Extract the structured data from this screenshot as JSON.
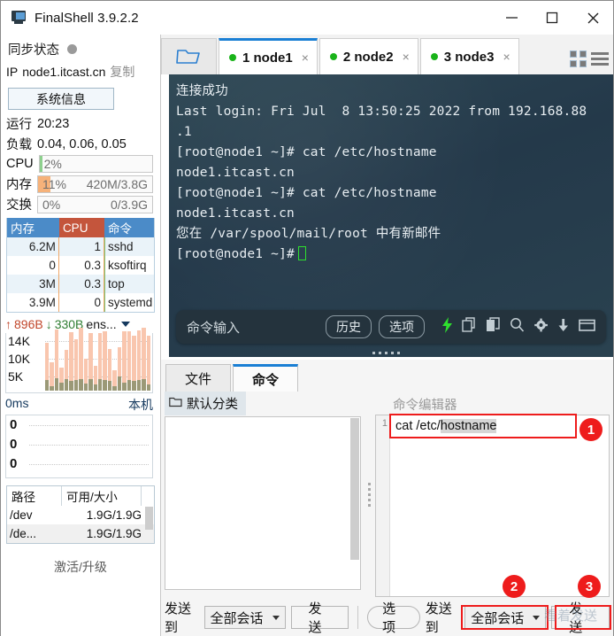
{
  "window": {
    "title": "FinalShell 3.9.2.2",
    "app_icon": "monitor-icon",
    "minimize": "minimize-icon",
    "maximize": "maximize-icon",
    "close": "close-icon"
  },
  "sidebar": {
    "sync_label": "同步状态",
    "ip_label": "IP",
    "ip_value": "node1.itcast.cn",
    "copy_label": "复制",
    "sysinfo_button": "系统信息",
    "stats": [
      {
        "key": "运行",
        "value": "20:23",
        "type": "text"
      },
      {
        "key": "负载",
        "value": "0.04, 0.06, 0.05",
        "type": "text"
      }
    ],
    "meters": [
      {
        "key": "CPU",
        "pct_text": "2%",
        "pct": 2,
        "right_text": "",
        "color": "#8ed08e"
      },
      {
        "key": "内存",
        "pct_text": "11%",
        "pct": 11,
        "right_text": "420M/3.8G",
        "color": "#f6b27a"
      },
      {
        "key": "交换",
        "pct_text": "0%",
        "pct": 0,
        "right_text": "0/3.9G",
        "color": "#f6b27a"
      }
    ],
    "process_table": {
      "headers": [
        "内存",
        "CPU",
        "命令"
      ],
      "rows": [
        {
          "mem": "6.2M",
          "cpu": "1",
          "cmd": "sshd"
        },
        {
          "mem": "0",
          "cpu": "0.3",
          "cmd": "ksoftirq"
        },
        {
          "mem": "3M",
          "cpu": "0.3",
          "cmd": "top"
        },
        {
          "mem": "3.9M",
          "cpu": "0",
          "cmd": "systemd"
        }
      ]
    },
    "network": {
      "up_arrow": "↑",
      "up_value": "896B",
      "down_arrow": "↓",
      "down_value": "330B",
      "interface": "ens...",
      "dropdown_icon": "chevron-down-icon",
      "y_labels": [
        "14K",
        "10K",
        "5K"
      ],
      "latency": "0ms",
      "host_label": "本机",
      "latency_y_labels": [
        "0",
        "0",
        "0"
      ]
    },
    "disk_table": {
      "headers": [
        "路径",
        "可用/大小",
        ""
      ],
      "rows": [
        {
          "path": "/dev",
          "size": "1.9G/1.9G"
        },
        {
          "path": "/de...",
          "size": "1.9G/1.9G"
        }
      ]
    },
    "activate_label": "激活/升级"
  },
  "tabbar": {
    "folder_icon": "open-folder-icon",
    "tabs": [
      {
        "label": "1 node1",
        "active": true,
        "status": "connected",
        "close": "×"
      },
      {
        "label": "2 node2",
        "active": false,
        "status": "connected",
        "close": "×"
      },
      {
        "label": "3 node3",
        "active": false,
        "status": "connected",
        "close": "×"
      }
    ],
    "grid_icon": "grid-view-icon",
    "menu_icon": "hamburger-menu-icon"
  },
  "terminal": {
    "lines": [
      "连接成功",
      "Last login: Fri Jul  8 13:50:25 2022 from 192.168.88",
      ".1",
      "[root@node1 ~]# cat /etc/hostname",
      "node1.itcast.cn",
      "[root@node1 ~]# cat /etc/hostname",
      "node1.itcast.cn",
      "您在 /var/spool/mail/root 中有新邮件",
      "[root@node1 ~]#"
    ]
  },
  "command_bar": {
    "placeholder": "命令输入",
    "history_button": "历史",
    "options_button": "选项",
    "icons": [
      "lightning-icon",
      "copy-icon",
      "paste-icon",
      "search-icon",
      "gear-icon",
      "download-icon",
      "window-icon"
    ]
  },
  "bottom_panel": {
    "tabs": [
      {
        "label": "文件",
        "active": false
      },
      {
        "label": "命令",
        "active": true
      }
    ],
    "category": {
      "folder_icon": "folder-icon",
      "label": "默认分类",
      "items": []
    },
    "editor": {
      "title": "命令编辑器",
      "lines": [
        {
          "number": "1",
          "prefix": "cat /etc/",
          "selected": "hostname"
        }
      ]
    },
    "toolbar": {
      "send_to_label_left": "发送到",
      "session_select_left": "全部会话",
      "send_button_left": "发送",
      "options_button": "选项",
      "send_to_label_right": "发送到",
      "session_select_right": "全部会话",
      "send_button_right": "发送"
    }
  },
  "annotations": [
    {
      "id": "1",
      "label": "1"
    },
    {
      "id": "2",
      "label": "2"
    },
    {
      "id": "3",
      "label": "3"
    }
  ],
  "watermark": "看着发送",
  "colors": {
    "accent": "#1a7fd4",
    "annotation": "#ee1c1c",
    "status_connected": "#19b319",
    "terminal_bg": "#2b4350"
  }
}
